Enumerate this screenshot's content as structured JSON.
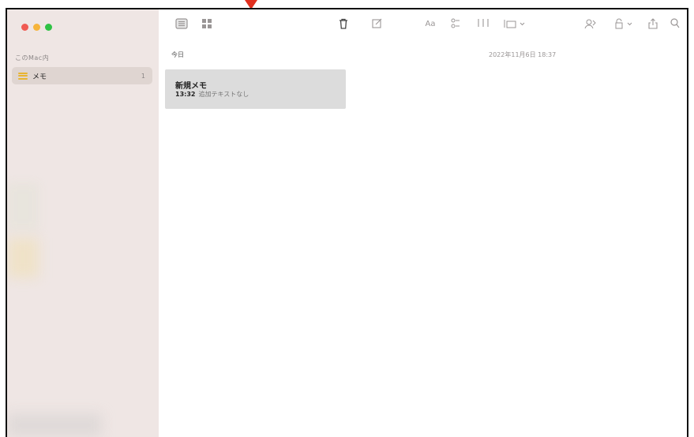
{
  "colors": {
    "pointer": "#e1301f",
    "sidebar_bg": "#efe6e4",
    "selected_folder_bg": "#dfd5d1",
    "note_card_bg": "#dcdcdc",
    "folder_icon": "#e8b431"
  },
  "sidebar": {
    "section_label": "このMac内",
    "folders": [
      {
        "label": "メモ",
        "count": "1",
        "icon": "list-icon"
      }
    ]
  },
  "toolbar": {
    "icons": [
      "list-view-icon",
      "gallery-view-icon",
      "trash-icon",
      "compose-icon",
      "format-icon",
      "checklist-icon",
      "table-icon",
      "media-icon",
      "collaborate-icon",
      "lock-icon",
      "share-icon",
      "search-icon"
    ],
    "format_label": "Aa"
  },
  "note_list": {
    "section_header": "今日",
    "date_header": "2022年11月6日 18:37",
    "notes": [
      {
        "title": "新規メモ",
        "time": "13:32",
        "preview": "追加テキストなし"
      }
    ]
  }
}
